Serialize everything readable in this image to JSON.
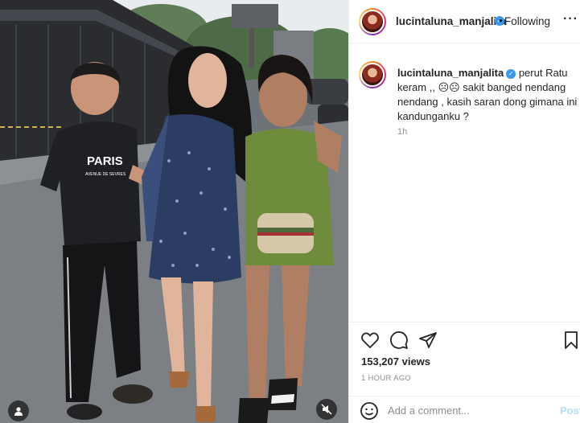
{
  "post": {
    "username": "lucintaluna_manjalita",
    "separator": "•",
    "follow_state": "Following",
    "more": "···",
    "caption_username": "lucintaluna_manjalita",
    "caption_text": "perut Ratu keram ,, ☹☹ sakit banged nendang nendang , kasih saran dong gimana ini kandunganku ?",
    "time_ago": "1h",
    "views": "153,207 views",
    "date": "1 HOUR AGO",
    "verified_glyph": "✓"
  },
  "comment": {
    "placeholder": "Add a comment...",
    "post_label": "Post"
  },
  "media": {
    "shirt_text": "PARIS",
    "shirt_subtext": "AVENUE DE SEVRES"
  },
  "colors": {
    "accent_blue": "#3897f0",
    "post_disabled": "#b2dffc",
    "border": "#efefef",
    "muted_text": "#8e8e8e"
  },
  "icons": [
    "tag-user-icon",
    "mute-icon",
    "heart-icon",
    "comment-icon",
    "share-icon",
    "bookmark-icon",
    "emoji-icon",
    "more-options-icon",
    "verified-badge-icon"
  ]
}
